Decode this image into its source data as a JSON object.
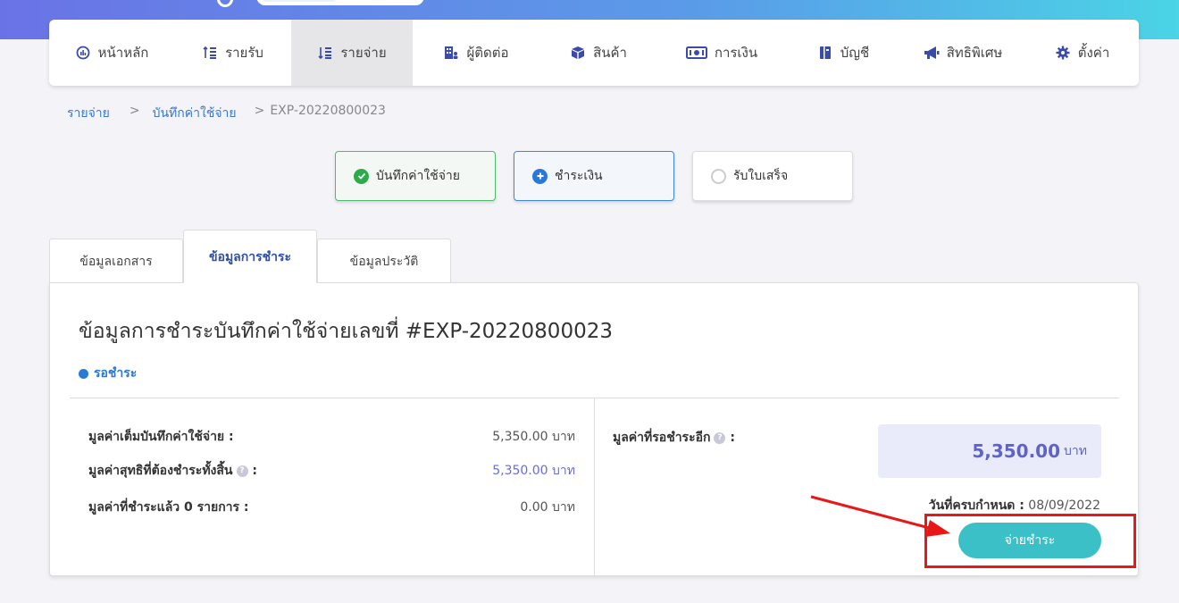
{
  "nav": {
    "items": [
      {
        "label": "หน้าหลัก",
        "icon": "dashboard-icon"
      },
      {
        "label": "รายรับ",
        "icon": "income-icon"
      },
      {
        "label": "รายจ่าย",
        "icon": "expense-icon",
        "active": true
      },
      {
        "label": "ผู้ติดต่อ",
        "icon": "contacts-icon"
      },
      {
        "label": "สินค้า",
        "icon": "box-icon"
      },
      {
        "label": "การเงิน",
        "icon": "money-icon"
      },
      {
        "label": "บัญชี",
        "icon": "book-icon"
      },
      {
        "label": "สิทธิพิเศษ",
        "icon": "megaphone-icon"
      },
      {
        "label": "ตั้งค่า",
        "icon": "gear-icon"
      }
    ]
  },
  "breadcrumb": {
    "level1": "รายจ่าย",
    "level2": "บันทึกค่าใช้จ่าย",
    "current": "EXP-20220800023",
    "separator": ">"
  },
  "steps": {
    "done": "บันทึกค่าใช้จ่าย",
    "current": "ชำระเงิน",
    "todo": "รับใบเสร็จ"
  },
  "tabs": {
    "doc": "ข้อมูลเอกสาร",
    "payment": "ข้อมูลการชำระ",
    "history": "ข้อมูลประวัติ"
  },
  "panel": {
    "title": "ข้อมูลการชำระบันทึกค่าใช้จ่ายเลขที่ #EXP-20220800023",
    "status": "รอชำระ",
    "rows": [
      {
        "label": "มูลค่าเต็มบันทึกค่าใช้จ่าย :",
        "value": "5,350.00 บาท"
      },
      {
        "label": "มูลค่าสุทธิที่ต้องชำระทั้งสิ้น",
        "suffix": ":",
        "value": "5,350.00 บาท"
      },
      {
        "label": "มูลค่าที่ชำระแล้ว 0 รายการ :",
        "value": "0.00 บาท"
      }
    ],
    "remaining": {
      "label": "มูลค่าที่รอชำระอีก",
      "suffix": ":",
      "amount": "5,350.00",
      "unit": "บาท"
    },
    "due": {
      "label": "วันที่ครบกำหนด :",
      "date": "08/09/2022"
    },
    "pay_button": "จ่ายชำระ"
  },
  "colors": {
    "accent": "#3cc0c8",
    "primary_blue": "#2a79d6",
    "success_green": "#2eaa4c",
    "annotation_red": "#e81818"
  }
}
